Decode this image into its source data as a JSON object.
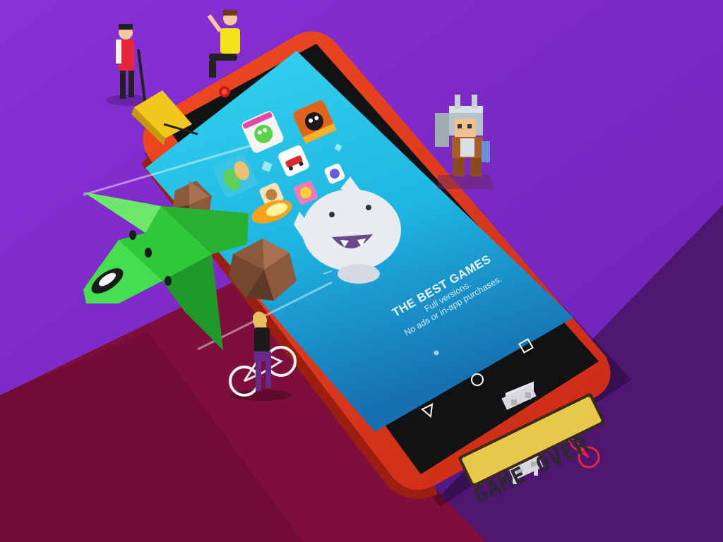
{
  "scene": {
    "colors": {
      "background_purple": "#7a28c8",
      "background_violet": "#5a1a7c",
      "background_crimson": "#8a1040",
      "phone_body": "#e23c1e",
      "screen_top": "#2ec8ea",
      "screen_bottom": "#1a76b8",
      "gameover_plate": "#e8c84a",
      "jet_green": "#2fcc3a"
    },
    "screen": {
      "title": "THE BEST GAMES",
      "line1": "Full versions.",
      "line2": "No ads or in-app purchases."
    },
    "sign": {
      "text": "GAME OVER"
    },
    "navbar": {
      "back_icon": "triangle-back-icon",
      "home_icon": "circle-home-icon",
      "recents_icon": "square-recents-icon"
    }
  }
}
